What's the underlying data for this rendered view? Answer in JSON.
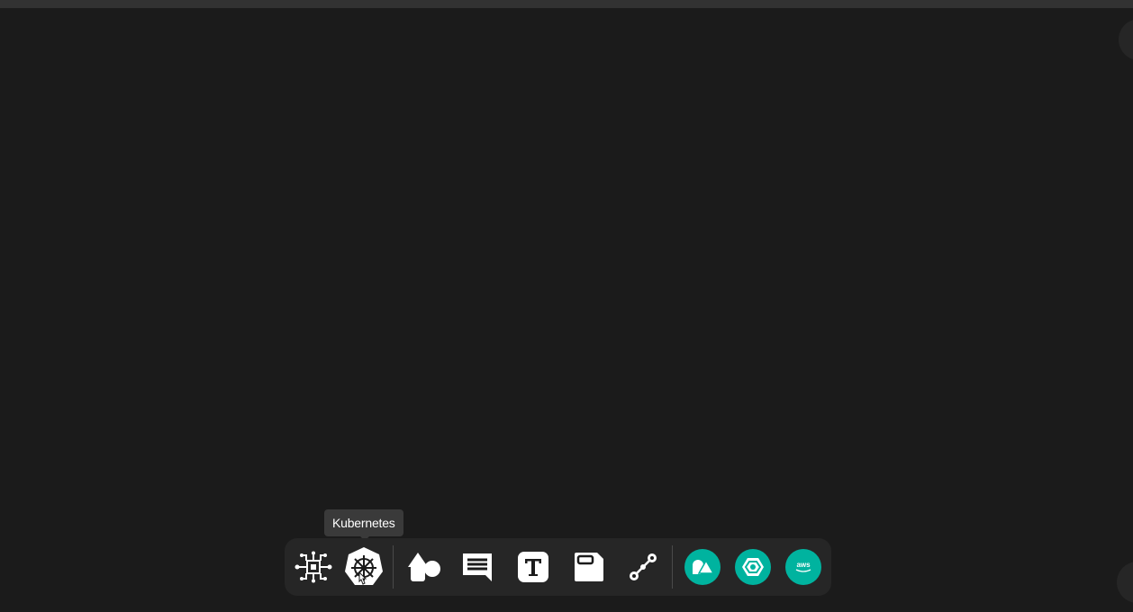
{
  "tooltip": {
    "text": "Kubernetes"
  },
  "colors": {
    "canvas": "#1b1b1b",
    "topbar": "#323232",
    "dock": "#262626",
    "accent": "#00b39f",
    "icon": "#ffffff"
  },
  "toolbar": {
    "tools": [
      {
        "name": "component-tool",
        "icon": "component-icon"
      },
      {
        "name": "kubernetes-tool",
        "icon": "kubernetes-icon"
      },
      {
        "name": "shapes-tool",
        "icon": "shapes-icon"
      },
      {
        "name": "comment-tool",
        "icon": "comment-icon"
      },
      {
        "name": "text-tool",
        "icon": "text-icon"
      },
      {
        "name": "section-tool",
        "icon": "section-icon"
      },
      {
        "name": "connector-tool",
        "icon": "connector-icon"
      },
      {
        "name": "shapes-library-button",
        "icon": "shapes-library-icon"
      },
      {
        "name": "gcp-button",
        "icon": "gcp-icon"
      },
      {
        "name": "aws-button",
        "icon": "aws-icon"
      }
    ],
    "aws_label": "aws"
  }
}
